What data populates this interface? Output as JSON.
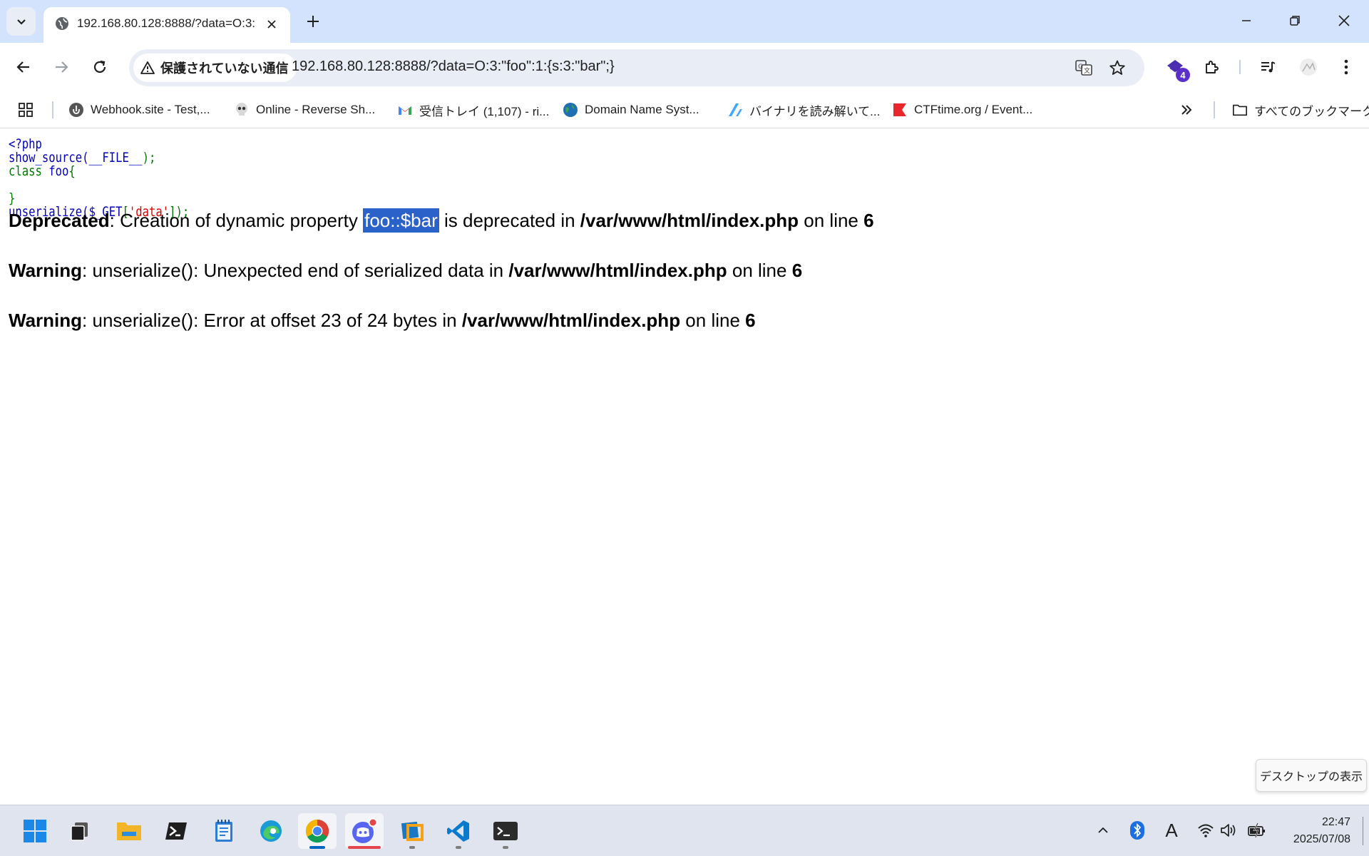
{
  "browser": {
    "tab": {
      "title": "192.168.80.128:8888/?data=O:3:"
    },
    "omnibox": {
      "security_label": "保護されていない通信",
      "url": "192.168.80.128:8888/?data=O:3:\"foo\":1:{s:3:\"bar\";}"
    },
    "extensions_badge": "4",
    "bookmarks": [
      {
        "label": "Webhook.site - Test,...",
        "icon": "webhook-icon"
      },
      {
        "label": "Online - Reverse Sh...",
        "icon": "skull-icon"
      },
      {
        "label": "受信トレイ (1,107) - ri...",
        "icon": "gmail-icon"
      },
      {
        "label": "Domain Name Syst...",
        "icon": "globe-icon"
      },
      {
        "label": "バイナリを読み解いて...",
        "icon": "zenn-icon"
      },
      {
        "label": "CTFtime.org / Event...",
        "icon": "ctftime-icon"
      }
    ],
    "all_bookmarks_label": "すべてのブックマーク"
  },
  "page": {
    "code_lines": {
      "l1": "<?php",
      "l2a": "show_source(",
      "l2b": "__FILE__",
      "l2c": ");",
      "l3a": "class ",
      "l3b": "foo",
      "l3c": "{",
      "l5": "}",
      "l6a": "unserialize(",
      "l6b": "$_GET",
      "l6c": "[",
      "l6d": "'data'",
      "l6e": "]);"
    },
    "messages": [
      {
        "level": "Deprecated",
        "text_before": ": Creation of dynamic property ",
        "highlight": "foo::$bar",
        "text_after": " is deprecated in ",
        "file": "/var/www/html/index.php",
        "on_line": " on line ",
        "line": "6"
      },
      {
        "level": "Warning",
        "text": ": unserialize(): Unexpected end of serialized data in ",
        "file": "/var/www/html/index.php",
        "on_line": " on line ",
        "line": "6"
      },
      {
        "level": "Warning",
        "text": ": unserialize(): Error at offset 23 of 24 bytes in ",
        "file": "/var/www/html/index.php",
        "on_line": " on line ",
        "line": "6"
      }
    ]
  },
  "tooltip": "デスクトップの表示",
  "taskbar": {
    "apps": [
      "start",
      "task-view",
      "file-explorer",
      "powershell",
      "notepad",
      "edge",
      "chrome",
      "discord",
      "virtualbox",
      "vscode",
      "terminal"
    ],
    "clock_time": "22:47",
    "clock_date": "2025/07/08",
    "ime_indicator": "A"
  },
  "colors": {
    "tab_strip": "#d3e3fd",
    "php_keyword_blue": "#0000bb",
    "php_default_green": "#007700",
    "php_string_red": "#dd0000",
    "selection": "#2a62c9"
  }
}
